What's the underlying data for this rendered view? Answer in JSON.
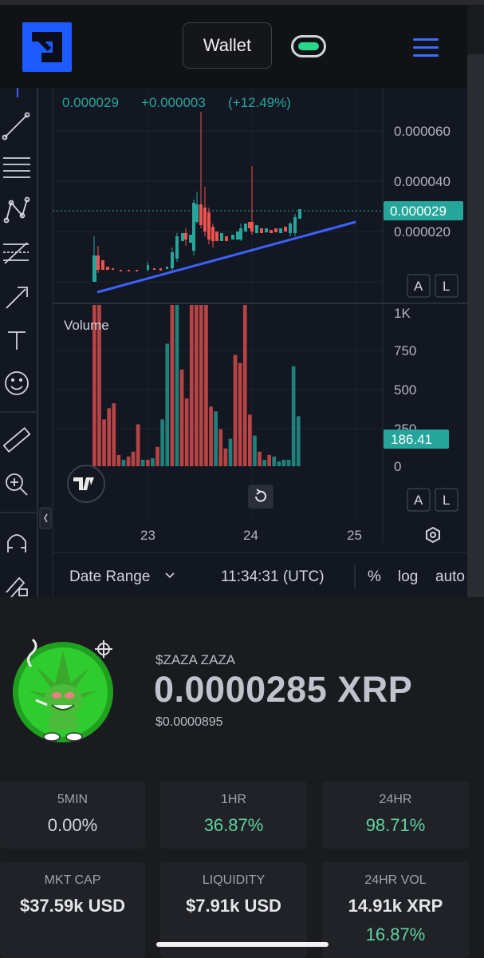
{
  "header": {
    "wallet_label": "Wallet",
    "accent_color": "#1e5bff",
    "toggle_color": "#27d78b"
  },
  "chart": {
    "legend": {
      "price": "0.000029",
      "change": "+0.000003",
      "change_pct": "(+12.49%)"
    },
    "price_axis": [
      "0.000060",
      "0.000040",
      "0.000020"
    ],
    "last_price_label": "0.000029",
    "volume_label": "Volume",
    "volume_axis": [
      "1K",
      "750",
      "500",
      "250",
      "0"
    ],
    "last_volume_label": "186.41",
    "date_axis": [
      "23",
      "24",
      "25"
    ],
    "btn_a": "A",
    "btn_l": "L",
    "footer": {
      "date_range": "Date Range",
      "time": "11:34:31 (UTC)",
      "percent": "%",
      "log": "log",
      "auto": "auto"
    },
    "icons": [
      "trend-line-icon",
      "horizontal-lines-icon",
      "pattern-icon",
      "fib-icon",
      "arrow-icon",
      "text-icon",
      "emoji-icon",
      "ruler-icon",
      "zoom-in-icon",
      "magnet-icon",
      "lock-pencil-icon",
      "settings-icon",
      "reset-icon",
      "tradingview-logo-icon"
    ],
    "up_color": "#26a69a",
    "down_color": "#ef5350"
  },
  "chart_data": {
    "type": "bar",
    "title": "",
    "xlabel": "",
    "ylabel": "Volume",
    "ylim": [
      0,
      1000
    ],
    "x_ticks": [
      "23",
      "24",
      "25"
    ],
    "values": [
      1000,
      1000,
      290,
      360,
      390,
      70,
      40,
      60,
      90,
      260,
      40,
      40,
      50,
      120,
      290,
      760,
      1000,
      1000,
      600,
      420,
      1000,
      1000,
      1000,
      1000,
      370,
      340,
      230,
      110,
      170,
      690,
      640,
      1000,
      320,
      190,
      90,
      40,
      70,
      60,
      30,
      40,
      40,
      620,
      310
    ]
  },
  "token": {
    "name": "$ZAZA ZAZA",
    "price_xrp": "0.0000285 XRP",
    "price_usd": "$0.0000895"
  },
  "stats": [
    {
      "label": "5MIN",
      "value": "0.00%",
      "type": "neutral"
    },
    {
      "label": "1HR",
      "value": "36.87%",
      "type": "pos"
    },
    {
      "label": "24HR",
      "value": "98.71%",
      "type": "pos"
    },
    {
      "label": "MKT CAP",
      "value": "$37.59k USD",
      "type": "bold"
    },
    {
      "label": "LIQUIDITY",
      "value": "$7.91k USD",
      "type": "bold"
    },
    {
      "label": "24HR VOL",
      "value": "14.91k XRP",
      "value2": "16.87%",
      "type": "bold"
    }
  ]
}
